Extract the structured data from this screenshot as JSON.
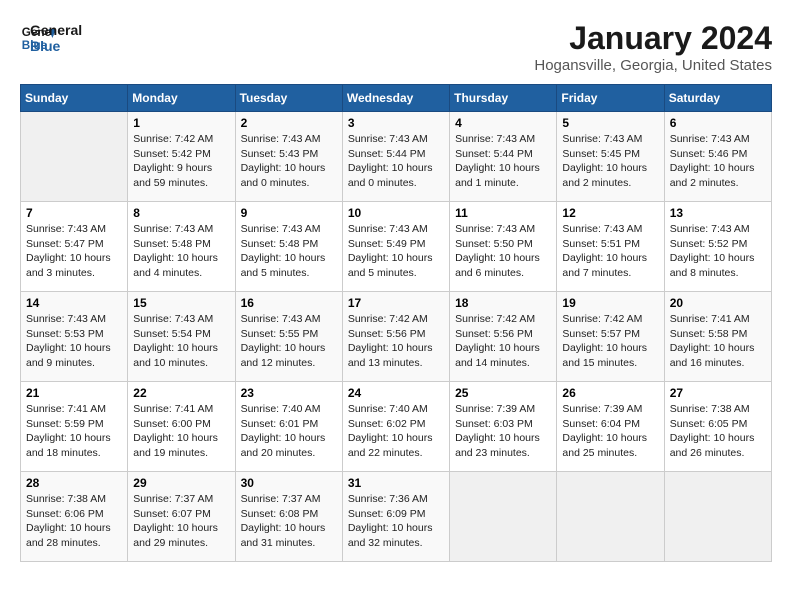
{
  "header": {
    "logo_line1": "General",
    "logo_line2": "Blue",
    "title": "January 2024",
    "subtitle": "Hogansville, Georgia, United States"
  },
  "days_of_week": [
    "Sunday",
    "Monday",
    "Tuesday",
    "Wednesday",
    "Thursday",
    "Friday",
    "Saturday"
  ],
  "weeks": [
    [
      {
        "num": "",
        "info": ""
      },
      {
        "num": "1",
        "info": "Sunrise: 7:42 AM\nSunset: 5:42 PM\nDaylight: 9 hours\nand 59 minutes."
      },
      {
        "num": "2",
        "info": "Sunrise: 7:43 AM\nSunset: 5:43 PM\nDaylight: 10 hours\nand 0 minutes."
      },
      {
        "num": "3",
        "info": "Sunrise: 7:43 AM\nSunset: 5:44 PM\nDaylight: 10 hours\nand 0 minutes."
      },
      {
        "num": "4",
        "info": "Sunrise: 7:43 AM\nSunset: 5:44 PM\nDaylight: 10 hours\nand 1 minute."
      },
      {
        "num": "5",
        "info": "Sunrise: 7:43 AM\nSunset: 5:45 PM\nDaylight: 10 hours\nand 2 minutes."
      },
      {
        "num": "6",
        "info": "Sunrise: 7:43 AM\nSunset: 5:46 PM\nDaylight: 10 hours\nand 2 minutes."
      }
    ],
    [
      {
        "num": "7",
        "info": "Sunrise: 7:43 AM\nSunset: 5:47 PM\nDaylight: 10 hours\nand 3 minutes."
      },
      {
        "num": "8",
        "info": "Sunrise: 7:43 AM\nSunset: 5:48 PM\nDaylight: 10 hours\nand 4 minutes."
      },
      {
        "num": "9",
        "info": "Sunrise: 7:43 AM\nSunset: 5:48 PM\nDaylight: 10 hours\nand 5 minutes."
      },
      {
        "num": "10",
        "info": "Sunrise: 7:43 AM\nSunset: 5:49 PM\nDaylight: 10 hours\nand 5 minutes."
      },
      {
        "num": "11",
        "info": "Sunrise: 7:43 AM\nSunset: 5:50 PM\nDaylight: 10 hours\nand 6 minutes."
      },
      {
        "num": "12",
        "info": "Sunrise: 7:43 AM\nSunset: 5:51 PM\nDaylight: 10 hours\nand 7 minutes."
      },
      {
        "num": "13",
        "info": "Sunrise: 7:43 AM\nSunset: 5:52 PM\nDaylight: 10 hours\nand 8 minutes."
      }
    ],
    [
      {
        "num": "14",
        "info": "Sunrise: 7:43 AM\nSunset: 5:53 PM\nDaylight: 10 hours\nand 9 minutes."
      },
      {
        "num": "15",
        "info": "Sunrise: 7:43 AM\nSunset: 5:54 PM\nDaylight: 10 hours\nand 10 minutes."
      },
      {
        "num": "16",
        "info": "Sunrise: 7:43 AM\nSunset: 5:55 PM\nDaylight: 10 hours\nand 12 minutes."
      },
      {
        "num": "17",
        "info": "Sunrise: 7:42 AM\nSunset: 5:56 PM\nDaylight: 10 hours\nand 13 minutes."
      },
      {
        "num": "18",
        "info": "Sunrise: 7:42 AM\nSunset: 5:56 PM\nDaylight: 10 hours\nand 14 minutes."
      },
      {
        "num": "19",
        "info": "Sunrise: 7:42 AM\nSunset: 5:57 PM\nDaylight: 10 hours\nand 15 minutes."
      },
      {
        "num": "20",
        "info": "Sunrise: 7:41 AM\nSunset: 5:58 PM\nDaylight: 10 hours\nand 16 minutes."
      }
    ],
    [
      {
        "num": "21",
        "info": "Sunrise: 7:41 AM\nSunset: 5:59 PM\nDaylight: 10 hours\nand 18 minutes."
      },
      {
        "num": "22",
        "info": "Sunrise: 7:41 AM\nSunset: 6:00 PM\nDaylight: 10 hours\nand 19 minutes."
      },
      {
        "num": "23",
        "info": "Sunrise: 7:40 AM\nSunset: 6:01 PM\nDaylight: 10 hours\nand 20 minutes."
      },
      {
        "num": "24",
        "info": "Sunrise: 7:40 AM\nSunset: 6:02 PM\nDaylight: 10 hours\nand 22 minutes."
      },
      {
        "num": "25",
        "info": "Sunrise: 7:39 AM\nSunset: 6:03 PM\nDaylight: 10 hours\nand 23 minutes."
      },
      {
        "num": "26",
        "info": "Sunrise: 7:39 AM\nSunset: 6:04 PM\nDaylight: 10 hours\nand 25 minutes."
      },
      {
        "num": "27",
        "info": "Sunrise: 7:38 AM\nSunset: 6:05 PM\nDaylight: 10 hours\nand 26 minutes."
      }
    ],
    [
      {
        "num": "28",
        "info": "Sunrise: 7:38 AM\nSunset: 6:06 PM\nDaylight: 10 hours\nand 28 minutes."
      },
      {
        "num": "29",
        "info": "Sunrise: 7:37 AM\nSunset: 6:07 PM\nDaylight: 10 hours\nand 29 minutes."
      },
      {
        "num": "30",
        "info": "Sunrise: 7:37 AM\nSunset: 6:08 PM\nDaylight: 10 hours\nand 31 minutes."
      },
      {
        "num": "31",
        "info": "Sunrise: 7:36 AM\nSunset: 6:09 PM\nDaylight: 10 hours\nand 32 minutes."
      },
      {
        "num": "",
        "info": ""
      },
      {
        "num": "",
        "info": ""
      },
      {
        "num": "",
        "info": ""
      }
    ]
  ]
}
